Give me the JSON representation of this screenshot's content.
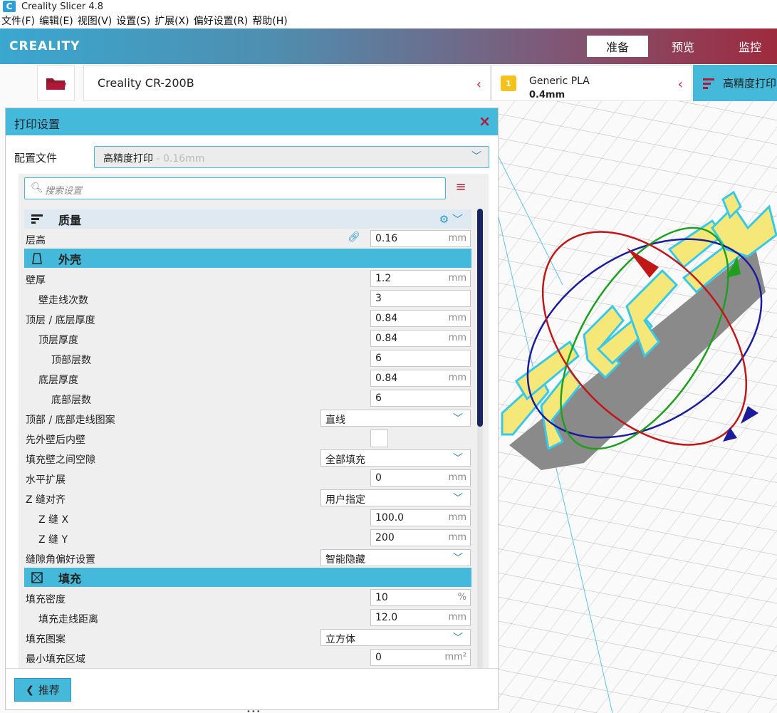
{
  "window": {
    "title": "Creality Slicer 4.8",
    "icon_letter": "C"
  },
  "menu": [
    "文件(F)",
    "编辑(E)",
    "视图(V)",
    "设置(S)",
    "扩展(X)",
    "偏好设置(R)",
    "帮助(H)"
  ],
  "header": {
    "logo": "CREALITY",
    "tabs": [
      {
        "label": "准备",
        "active": true
      },
      {
        "label": "预览",
        "active": false
      },
      {
        "label": "监控",
        "active": false
      }
    ]
  },
  "printer": {
    "name": "Creality CR-200B"
  },
  "material": {
    "extruder": "1",
    "name": "Generic PLA",
    "nozzle": "0.4mm"
  },
  "profile_tab": {
    "label": "高精度打印"
  },
  "panel": {
    "title": "打印设置",
    "close": "×",
    "profile_label": "配置文件",
    "profile_value": "高精度打印",
    "profile_suffix": " - 0.16mm",
    "search_placeholder": "搜索设置",
    "recommend_label": "推荐"
  },
  "categories": {
    "quality": "质量",
    "shell": "外壳",
    "infill": "填充"
  },
  "settings": {
    "layer_height": {
      "label": "层高",
      "value": "0.16",
      "unit": "mm"
    },
    "wall_thickness": {
      "label": "壁厚",
      "value": "1.2",
      "unit": "mm"
    },
    "wall_line_count": {
      "label": "壁走线次数",
      "value": "3"
    },
    "top_bottom_thickness": {
      "label": "顶层 / 底层厚度",
      "value": "0.84",
      "unit": "mm"
    },
    "top_thickness": {
      "label": "顶层厚度",
      "value": "0.84",
      "unit": "mm"
    },
    "top_layers": {
      "label": "顶部层数",
      "value": "6"
    },
    "bottom_thickness": {
      "label": "底层厚度",
      "value": "0.84",
      "unit": "mm"
    },
    "bottom_layers": {
      "label": "底部层数",
      "value": "6"
    },
    "top_bottom_pattern": {
      "label": "顶部 / 底部走线图案",
      "value": "直线"
    },
    "outer_before_inner": {
      "label": "先外壁后内壁"
    },
    "fill_gaps": {
      "label": "填充壁之间空隙",
      "value": "全部填充"
    },
    "horizontal_expansion": {
      "label": "水平扩展",
      "value": "0",
      "unit": "mm"
    },
    "z_seam_alignment": {
      "label": "Z 缝对齐",
      "value": "用户指定"
    },
    "z_seam_x": {
      "label": "Z 缝 X",
      "value": "100.0",
      "unit": "mm"
    },
    "z_seam_y": {
      "label": "Z 缝 Y",
      "value": "200",
      "unit": "mm"
    },
    "seam_corner": {
      "label": "缝隙角偏好设置",
      "value": "智能隐藏"
    },
    "infill_density": {
      "label": "填充密度",
      "value": "10",
      "unit": "%"
    },
    "infill_line_distance": {
      "label": "填充走线距离",
      "value": "12.0",
      "unit": "mm"
    },
    "infill_pattern": {
      "label": "填充图案",
      "value": "立方体"
    },
    "min_infill_area": {
      "label": "最小填充区域",
      "value": "0",
      "unit": "mm²"
    }
  },
  "colors": {
    "accent": "#44b9d9",
    "brand_red": "#b0183a",
    "model_yellow": "#f6e878",
    "model_outline": "#3ac8e8"
  }
}
